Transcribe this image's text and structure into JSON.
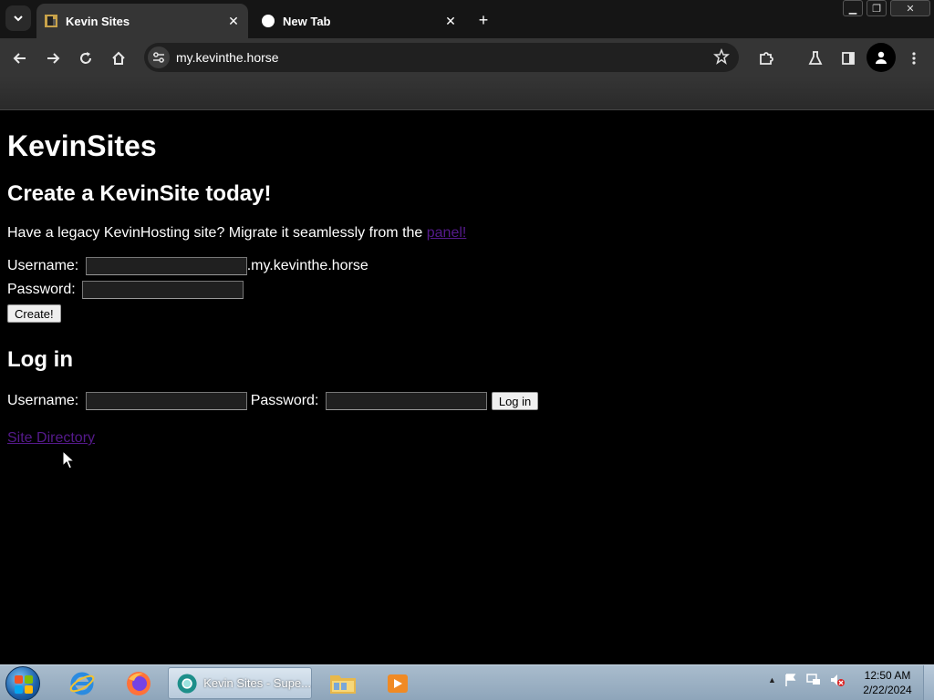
{
  "browser": {
    "tabs": [
      {
        "title": "Kevin Sites",
        "active": true
      },
      {
        "title": "New Tab",
        "active": false
      }
    ],
    "address": "my.kevinthe.horse",
    "window_controls": {
      "minimize": "▁",
      "restore": "❐",
      "close": "✕"
    }
  },
  "page": {
    "site_title": "KevinSites",
    "create": {
      "heading": "Create a KevinSite today!",
      "migrate_text": "Have a legacy KevinHosting site? Migrate it seamlessly from the ",
      "migrate_link": "panel!",
      "username_label": "Username: ",
      "username_value": "",
      "domain_suffix": ".my.kevinthe.horse",
      "password_label": "Password: ",
      "password_value": "",
      "submit_label": "Create!"
    },
    "login": {
      "heading": "Log in",
      "username_label": "Username: ",
      "username_value": "",
      "password_label": "Password: ",
      "password_value": "",
      "submit_label": "Log in"
    },
    "directory_link": "Site Directory"
  },
  "taskbar": {
    "open_window_label": "Kevin Sites - Supe...",
    "time": "12:50 AM",
    "date": "2/22/2024"
  },
  "colors": {
    "page_bg": "#000000",
    "visited_link": "#551a8b",
    "chrome_toolbar": "#353535",
    "taskbar": "#a9bccd"
  }
}
